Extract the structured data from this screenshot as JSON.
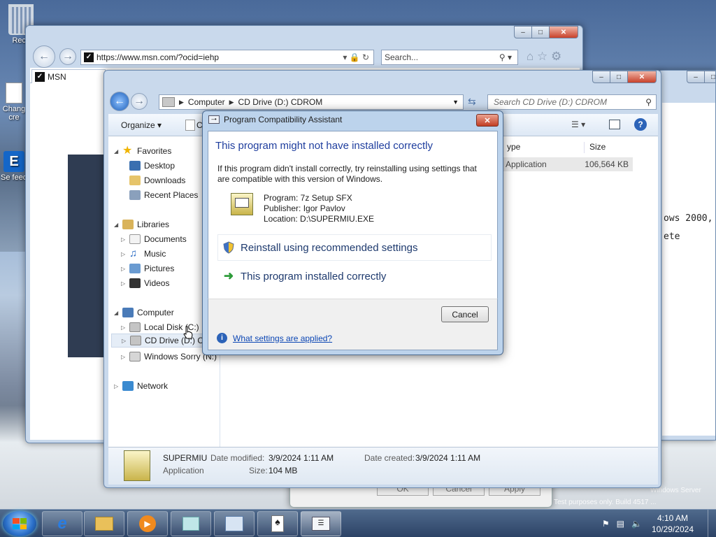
{
  "desktop": {
    "icons": [
      {
        "label": "Recy"
      },
      {
        "label": "Chang cre"
      },
      {
        "label": "Se feed"
      }
    ],
    "watermark_line1": "Windows Server",
    "watermark_line2": "Test purposes only. Build 4517 ..."
  },
  "browser": {
    "url": "https://www.msn.com/?ocid=iehp",
    "search_placeholder": "Search...",
    "tab_label": "MSN"
  },
  "bg_window": {
    "lines": [
      "ows 2000,",
      "ete"
    ]
  },
  "behind_dialog": {
    "ok": "OK",
    "cancel": "Cancel",
    "apply": "Apply"
  },
  "explorer": {
    "breadcrumb": [
      "Computer",
      "CD Drive (D:) CDROM"
    ],
    "search_placeholder": "Search CD Drive (D:) CDROM",
    "toolbar": {
      "organize": "Organize",
      "share_partial": "C"
    },
    "columns": {
      "type": "ype",
      "size": "Size"
    },
    "file_row": {
      "type": "Application",
      "size": "106,564 KB"
    },
    "nav": {
      "favorites": "Favorites",
      "desktop": "Desktop",
      "downloads": "Downloads",
      "recent": "Recent Places",
      "libraries": "Libraries",
      "documents": "Documents",
      "music": "Music",
      "pictures": "Pictures",
      "videos": "Videos",
      "computer": "Computer",
      "local_disk": "Local Disk (C:)",
      "cd_drive": "CD Drive (D:) CD",
      "windows_sorry": "Windows Sorry (N:)",
      "network": "Network"
    },
    "details": {
      "name": "SUPERMIU",
      "kind": "Application",
      "modified_label": "Date modified:",
      "modified_value": "3/9/2024 1:11 AM",
      "size_label": "Size:",
      "size_value": "104 MB",
      "created_label": "Date created:",
      "created_value": "3/9/2024 1:11 AM"
    }
  },
  "dialog": {
    "title": "Program Compatibility Assistant",
    "heading": "This program might not have installed correctly",
    "body": "If this program didn't install correctly, try reinstalling using settings that are compatible with this version of Windows.",
    "program": "Program: 7z Setup SFX",
    "publisher": "Publisher: Igor Pavlov",
    "location": "Location: D:\\SUPERMIU.EXE",
    "option_reinstall": "Reinstall using recommended settings",
    "option_ok": "This program installed correctly",
    "cancel": "Cancel",
    "help_link": "What settings are applied?"
  },
  "taskbar": {
    "time": "4:10 AM",
    "date": "10/29/2024"
  },
  "colors": {
    "dialog_heading": "#1f3e9e",
    "link": "#0b46b4",
    "close_red": "#c23e24"
  }
}
